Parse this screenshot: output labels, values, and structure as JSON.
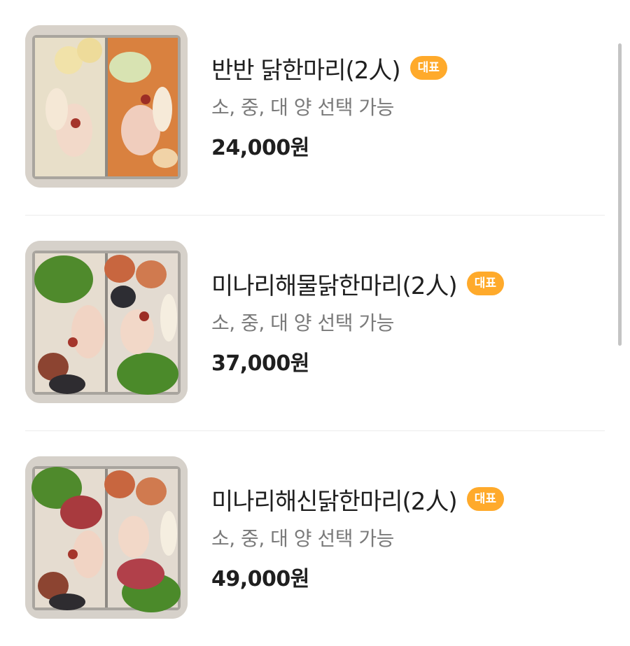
{
  "menu": {
    "items": [
      {
        "name": "반반 닭한마리(2人)",
        "badge": "대표",
        "option": "소, 중, 대 양 선택 가능",
        "price": "24,000원",
        "image": "half-half-chicken-hotpot-photo"
      },
      {
        "name": "미나리해물닭한마리(2人)",
        "badge": "대표",
        "option": "소, 중, 대 양 선택 가능",
        "price": "37,000원",
        "image": "minari-seafood-chicken-hotpot-photo"
      },
      {
        "name": "미나리해신닭한마리(2人)",
        "badge": "대표",
        "option": "소, 중, 대 양 선택 가능",
        "price": "49,000원",
        "image": "minari-octopus-chicken-hotpot-photo"
      }
    ]
  },
  "colors": {
    "badge": "#ffaa2b",
    "title": "#1f1f1f",
    "option": "#7a7a7a",
    "divider": "#ececec"
  }
}
